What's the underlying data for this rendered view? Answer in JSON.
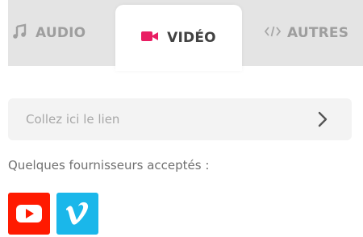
{
  "tabs": {
    "audio_label": "AUDIO",
    "video_label": "VIDÉO",
    "other_label": "AUTRES",
    "active": "video"
  },
  "link_input": {
    "placeholder": "Collez ici le lien",
    "value": ""
  },
  "providers": {
    "label": "Quelques fournisseurs acceptés :",
    "items": [
      {
        "name": "YouTube",
        "icon": "youtube-icon",
        "color": "#ff1a00"
      },
      {
        "name": "Vimeo",
        "icon": "vimeo-icon",
        "color": "#1ab7ea"
      }
    ]
  },
  "colors": {
    "accent": "#e91e63",
    "tab_inactive_text": "#9e9e9e",
    "tab_bar_bg": "#e4e4e4"
  }
}
